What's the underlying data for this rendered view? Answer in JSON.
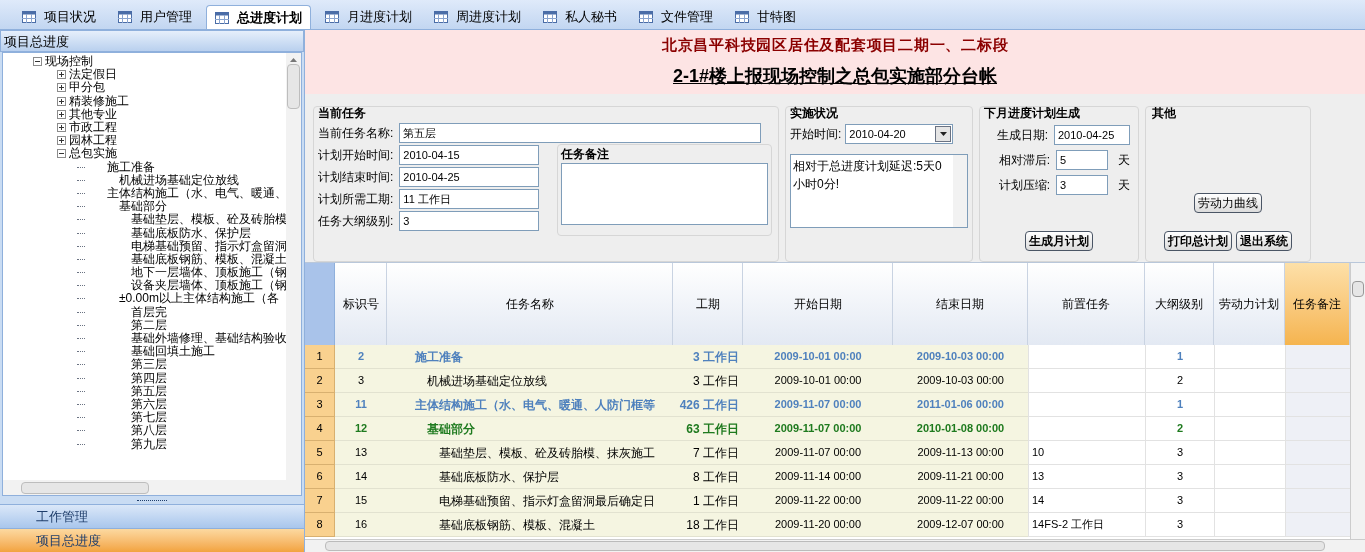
{
  "tabs": [
    {
      "label": "项目状况",
      "selected": false
    },
    {
      "label": "用户管理",
      "selected": false
    },
    {
      "label": "总进度计划",
      "selected": true
    },
    {
      "label": "月进度计划",
      "selected": false
    },
    {
      "label": "周进度计划",
      "selected": false
    },
    {
      "label": "私人秘书",
      "selected": false
    },
    {
      "label": "文件管理",
      "selected": false
    },
    {
      "label": "甘特图",
      "selected": false
    }
  ],
  "sidebar": {
    "title": "项目总进度",
    "tree": [
      {
        "label": "现场控制",
        "expanded": true,
        "children": [
          {
            "label": "法定假日",
            "expanded": false
          },
          {
            "label": "甲分包",
            "expanded": false
          },
          {
            "label": "精装修施工",
            "expanded": false
          },
          {
            "label": "其他专业",
            "expanded": false
          },
          {
            "label": "市政工程",
            "expanded": false
          },
          {
            "label": "园林工程",
            "expanded": false
          },
          {
            "label": "总包实施",
            "expanded": true,
            "children": [
              {
                "label": "施工准备",
                "children": [
                  {
                    "label": "机械进场基础定位放线"
                  }
                ]
              },
              {
                "label": "主体结构施工（水、电气、暖通、",
                "children": [
                  {
                    "label": "基础部分",
                    "children": [
                      {
                        "label": "基础垫层、模板、砼及砖胎模"
                      },
                      {
                        "label": "基础底板防水、保护层"
                      },
                      {
                        "label": "电梯基础预留、指示灯盒留洞"
                      },
                      {
                        "label": "基础底板钢筋、模板、混凝土"
                      },
                      {
                        "label": "地下一层墙体、顶板施工（钢"
                      },
                      {
                        "label": "设备夹层墙体、顶板施工（钢"
                      }
                    ]
                  },
                  {
                    "label": "±0.00m以上主体结构施工（各",
                    "children": [
                      {
                        "label": "首层完"
                      },
                      {
                        "label": "第二层"
                      },
                      {
                        "label": "基础外墙修理、基础结构验收"
                      },
                      {
                        "label": "基础回填土施工"
                      },
                      {
                        "label": "第三层"
                      },
                      {
                        "label": "第四层"
                      },
                      {
                        "label": "第五层"
                      },
                      {
                        "label": "第六层"
                      },
                      {
                        "label": "第七层"
                      },
                      {
                        "label": "第八层"
                      },
                      {
                        "label": "第九层"
                      }
                    ]
                  }
                ]
              }
            ]
          }
        ]
      }
    ],
    "nav": [
      {
        "label": "工作管理",
        "selected": false
      },
      {
        "label": "项目总进度",
        "selected": true
      }
    ]
  },
  "header": {
    "project": "北京昌平科技园区居住及配套项目二期一、二标段",
    "title": "2-1#楼上报现场控制之总包实施部分台帐"
  },
  "current_task": {
    "heading": "当前任务",
    "fields": [
      {
        "label": "当前任务名称:",
        "value": "第五层"
      },
      {
        "label": "计划开始时间:",
        "value": "2010-04-15"
      },
      {
        "label": "计划结束时间:",
        "value": "2010-04-25"
      },
      {
        "label": "计划所需工期:",
        "value": "11 工作日"
      },
      {
        "label": "任务大纲级别:",
        "value": "3"
      }
    ],
    "notes_heading": "任务备注"
  },
  "status": {
    "heading": "实施状况",
    "start_label": "开始时间:",
    "start_value": "2010-04-20",
    "message": "相对于总进度计划延迟:5天0小时0分!"
  },
  "next_month": {
    "heading": "下月进度计划生成",
    "fields": [
      {
        "label": "生成日期:",
        "value": "2010-04-25"
      },
      {
        "label": "相对滞后:",
        "value": "5",
        "unit": "天"
      },
      {
        "label": "计划压缩:",
        "value": "3",
        "unit": "天"
      }
    ],
    "button": "生成月计划"
  },
  "other": {
    "heading": "其他",
    "buttons": [
      "劳动力曲线",
      "打印总计划",
      "退出系统"
    ]
  },
  "table": {
    "columns": [
      {
        "label": "标识号",
        "selected": false
      },
      {
        "label": "任务名称",
        "selected": false
      },
      {
        "label": "工期",
        "selected": false
      },
      {
        "label": "开始日期",
        "selected": false
      },
      {
        "label": "结束日期",
        "selected": false
      },
      {
        "label": "前置任务",
        "selected": false
      },
      {
        "label": "大纲级别",
        "selected": false
      },
      {
        "label": "劳动力计划",
        "selected": false
      },
      {
        "label": "任务备注",
        "selected": true
      }
    ],
    "rows": [
      {
        "kind": "summary",
        "row_number": "1",
        "id": "2",
        "name": "施工准备",
        "duration": "3 工作日",
        "start": "2009-10-01 00:00",
        "end": "2009-10-03 00:00",
        "outline_level": "1"
      },
      {
        "kind": "task",
        "row_number": "2",
        "id": "3",
        "name": "机械进场基础定位放线",
        "duration": "3 工作日",
        "start": "2009-10-01 00:00",
        "end": "2009-10-03 00:00",
        "outline_level": "2"
      },
      {
        "kind": "summary",
        "row_number": "3",
        "id": "11",
        "name": "主体结构施工（水、电气、暖通、人防门框等",
        "duration": "426 工作日",
        "start": "2009-11-07 00:00",
        "end": "2011-01-06 00:00",
        "outline_level": "1"
      },
      {
        "kind": "group",
        "row_number": "4",
        "id": "12",
        "name": "基础部分",
        "duration": "63 工作日",
        "start": "2009-11-07 00:00",
        "end": "2010-01-08 00:00",
        "outline_level": "2"
      },
      {
        "kind": "task",
        "row_number": "5",
        "id": "13",
        "name": "基础垫层、模板、砼及砖胎模、抹灰施工",
        "duration": "7 工作日",
        "start": "2009-11-07 00:00",
        "end": "2009-11-13 00:00",
        "predecessor": "10",
        "outline_level": "3"
      },
      {
        "kind": "task",
        "row_number": "6",
        "id": "14",
        "name": "基础底板防水、保护层",
        "duration": "8 工作日",
        "start": "2009-11-14 00:00",
        "end": "2009-11-21 00:00",
        "predecessor": "13",
        "outline_level": "3"
      },
      {
        "kind": "task",
        "row_number": "7",
        "id": "15",
        "name": "电梯基础预留、指示灯盒留洞最后确定日",
        "duration": "1 工作日",
        "start": "2009-11-22 00:00",
        "end": "2009-11-22 00:00",
        "predecessor": "14",
        "outline_level": "3"
      },
      {
        "kind": "task",
        "row_number": "8",
        "id": "16",
        "name": "基础底板钢筋、模板、混凝土",
        "duration": "18 工作日",
        "start": "2009-11-20 00:00",
        "end": "2009-12-07 00:00",
        "predecessor": "14FS-2 工作日",
        "outline_level": "3"
      }
    ]
  }
}
